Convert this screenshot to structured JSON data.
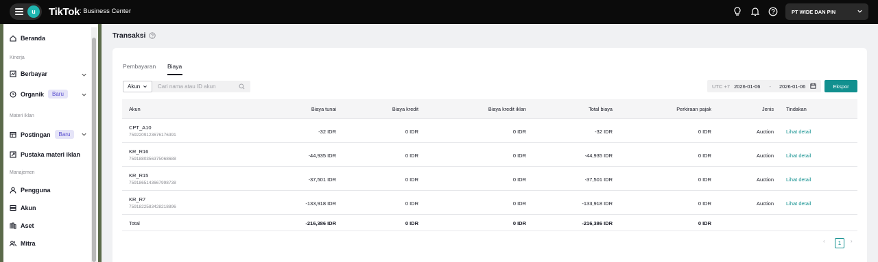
{
  "topbar": {
    "menu_avatar_letter": "u",
    "brand": "TikTok",
    "brand_sub": ": Business Center",
    "account_name": "PT WIDE DAN PIN",
    "icons": [
      "lightbulb-icon",
      "bell-icon",
      "help-icon",
      "chevron-down-icon"
    ]
  },
  "sidebar": {
    "home": "Beranda",
    "section_kinerja": "Kinerja",
    "berbayar": "Berbayar",
    "organik": "Organik",
    "organik_badge": "Baru",
    "section_materi": "Materi iklan",
    "postingan": "Postingan",
    "postingan_badge": "Baru",
    "pustaka": "Pustaka materi iklan",
    "section_manajemen": "Manajemen",
    "pengguna": "Pengguna",
    "akun": "Akun",
    "aset": "Aset",
    "mitra": "Mitra"
  },
  "main": {
    "title": "Transaksi",
    "tabs": [
      "Pembayaran",
      "Biaya"
    ],
    "active_tab": "Biaya",
    "filter_select": "Akun",
    "search_placeholder": "Cari nama atau ID akun",
    "timezone": "UTC +7",
    "date_start": "2026-01-06",
    "date_sep": "-",
    "date_end": "2026-01-06",
    "export_label": "Ekspor"
  },
  "table": {
    "headers": {
      "akun": "Akun",
      "biaya_tunai": "Biaya tunai",
      "biaya_kredit": "Biaya kredit",
      "biaya_kredit_iklan": "Biaya kredit iklan",
      "total_biaya": "Total biaya",
      "perkiraan_pajak": "Perkiraan pajak",
      "jenis": "Jenis",
      "tindakan": "Tindakan"
    },
    "rows": [
      {
        "name": "CPT_A10",
        "id": "7592209123676176391",
        "tunai": "-32 IDR",
        "kredit": "0 IDR",
        "kredit_iklan": "0 IDR",
        "total": "-32 IDR",
        "pajak": "0 IDR",
        "jenis": "Auction",
        "action": "Lihat detail"
      },
      {
        "name": "KR_R16",
        "id": "7591880356375068688",
        "tunai": "-44,935 IDR",
        "kredit": "0 IDR",
        "kredit_iklan": "0 IDR",
        "total": "-44,935 IDR",
        "pajak": "0 IDR",
        "jenis": "Auction",
        "action": "Lihat detail"
      },
      {
        "name": "KR_R15",
        "id": "7591865143667998738",
        "tunai": "-37,501 IDR",
        "kredit": "0 IDR",
        "kredit_iklan": "0 IDR",
        "total": "-37,501 IDR",
        "pajak": "0 IDR",
        "jenis": "Auction",
        "action": "Lihat detail"
      },
      {
        "name": "KR_R7",
        "id": "7591822583428218896",
        "tunai": "-133,918 IDR",
        "kredit": "0 IDR",
        "kredit_iklan": "0 IDR",
        "total": "-133,918 IDR",
        "pajak": "0 IDR",
        "jenis": "Auction",
        "action": "Lihat detail"
      }
    ],
    "total": {
      "label": "Total",
      "tunai": "-216,386 IDR",
      "kredit": "0 IDR",
      "kredit_iklan": "0 IDR",
      "total": "-216,386 IDR",
      "pajak": "0 IDR"
    }
  },
  "pagination": {
    "prev": "‹",
    "current": "1",
    "next": "›"
  },
  "colors": {
    "accent": "#12908f",
    "topbar": "#0b0b0b",
    "badge_bg": "#e5e4f8",
    "badge_text": "#5a4fcf"
  }
}
